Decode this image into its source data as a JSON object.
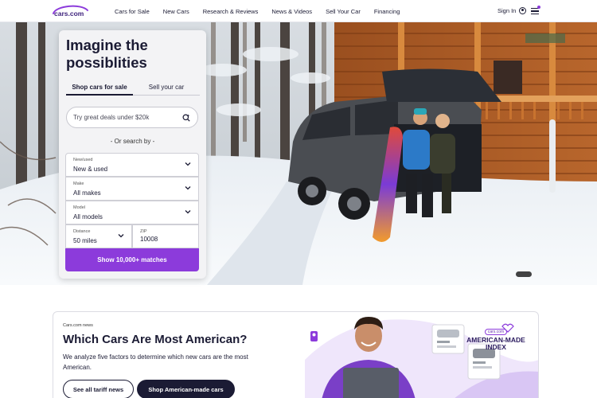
{
  "header": {
    "logo_text": "cars.com",
    "nav": [
      "Cars for Sale",
      "New Cars",
      "Research & Reviews",
      "News & Videos",
      "Sell Your Car",
      "Financing"
    ],
    "sign_in": "Sign In",
    "menu_icon": "hamburger-icon"
  },
  "hero": {
    "headline": "Imagine the possiblities",
    "tabs": [
      {
        "label": "Shop cars for sale",
        "active": true
      },
      {
        "label": "Sell your car",
        "active": false
      }
    ],
    "search_placeholder": "Try great deals under $20k",
    "or_search_by": "- Or search by -",
    "fields": {
      "new_used": {
        "label": "New/used",
        "value": "New & used"
      },
      "make": {
        "label": "Make",
        "value": "All makes"
      },
      "model": {
        "label": "Model",
        "value": "All models"
      },
      "distance": {
        "label": "Distance",
        "value": "50 miles"
      },
      "zip": {
        "label": "ZIP",
        "value": "10008"
      }
    },
    "cta": "Show 10,000+ matches"
  },
  "promo": {
    "eyebrow": "Cars.com news",
    "title": "Which Cars Are Most American?",
    "body": "We analyze five factors to determine which new cars are the most American.",
    "btn_tariff": "See all tariff news",
    "btn_shop": "Shop American-made cars",
    "badge_brand": "cars.com",
    "badge_line1": "AMERICAN-MADE",
    "badge_line2": "INDEX"
  },
  "colors": {
    "accent": "#8c3bdb",
    "dark": "#1b1b34"
  }
}
